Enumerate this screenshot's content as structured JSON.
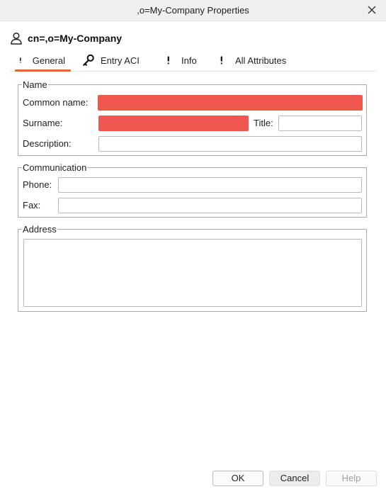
{
  "window": {
    "title": ",o=My-Company Properties",
    "close_icon": "close-icon"
  },
  "entry": {
    "icon": "user-icon",
    "title": "cn=,o=My-Company"
  },
  "tabs": [
    {
      "label": "General",
      "icon": "exclamation-icon",
      "active": true
    },
    {
      "label": "Entry ACI",
      "icon": "key-icon",
      "active": false
    },
    {
      "label": "Info",
      "icon": "exclamation-icon",
      "active": false
    },
    {
      "label": "All Attributes",
      "icon": "exclamation-icon",
      "active": false
    }
  ],
  "name_group": {
    "legend": "Name",
    "common_name_label": "Common name:",
    "common_name_value": "",
    "surname_label": "Surname:",
    "surname_value": "",
    "title_label": "Title:",
    "title_value": "",
    "description_label": "Description:",
    "description_value": ""
  },
  "communication_group": {
    "legend": "Communication",
    "phone_label": "Phone:",
    "phone_value": "",
    "fax_label": "Fax:",
    "fax_value": ""
  },
  "address_group": {
    "legend": "Address",
    "address_value": ""
  },
  "buttons": {
    "ok": "OK",
    "cancel": "Cancel",
    "help": "Help"
  },
  "colors": {
    "accent": "#e2673c",
    "redaction": "#ef5650"
  }
}
